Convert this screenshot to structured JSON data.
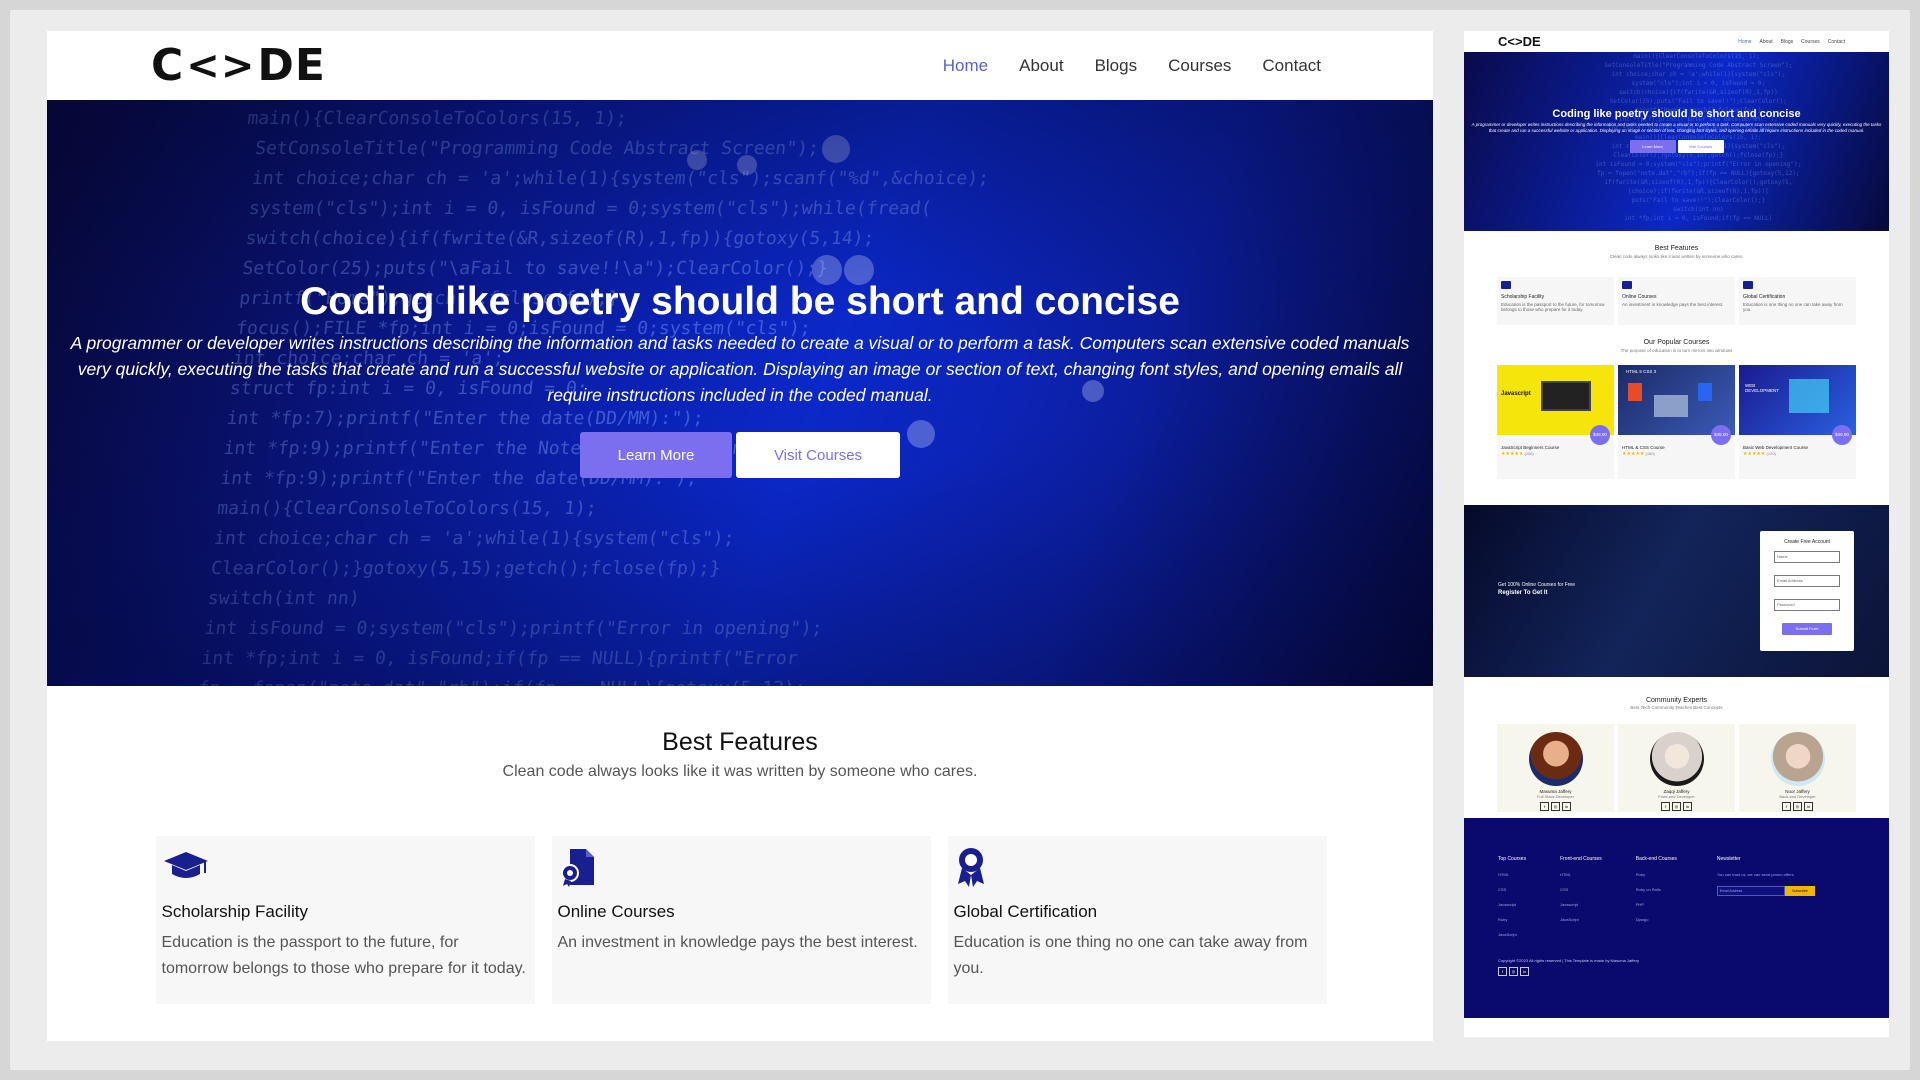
{
  "brand": {
    "logo_left": "C",
    "logo_symbol": "<>",
    "logo_right": "DE",
    "accent": "#7b6ff0",
    "navy": "#1a1f8f"
  },
  "nav": {
    "items": [
      {
        "label": "Home",
        "active": true
      },
      {
        "label": "About"
      },
      {
        "label": "Blogs"
      },
      {
        "label": "Courses"
      },
      {
        "label": "Contact"
      }
    ]
  },
  "hero": {
    "title": "Coding like poetry should be short and concise",
    "text": "A programmer or developer writes instructions describing the information and tasks needed to create a visual or to perform a task. Computers scan extensive coded manuals very quickly, executing the tasks that create and run a successful website or application. Displaying an image or section of text, changing font styles, and opening emails all require instructions included in the coded manual.",
    "primary_button": "Learn More",
    "secondary_button": "Visit Courses"
  },
  "features": {
    "title": "Best Features",
    "subtitle": "Clean code always looks like it was written by someone who cares.",
    "items": [
      {
        "icon": "graduation-cap-icon",
        "title": "Scholarship Facility",
        "text": "Education is the passport to the future, for tomorrow belongs to those who prepare for it today."
      },
      {
        "icon": "document-badge-icon",
        "title": "Online Courses",
        "text": "An investment in knowledge pays the best interest."
      },
      {
        "icon": "award-ribbon-icon",
        "title": "Global Certification",
        "text": "Education is one thing no one can take away from you."
      }
    ]
  },
  "preview": {
    "courses_title": "Our Popular Courses",
    "courses_subtitle": "The purpose of education is to turn mirrors into windows",
    "courses": [
      {
        "image_label": "Javascript",
        "price": "$49.00",
        "name": "JavaScript Beginners Course",
        "rating": "(256)"
      },
      {
        "image_label": "HTML 5 CSS 3",
        "price": "$49.00",
        "name": "HTML & CSS Course",
        "rating": "(160)"
      },
      {
        "image_label": "WEB DEVELOPMENT",
        "price": "$49.00",
        "name": "Basic Web Development Course",
        "rating": "(120)"
      }
    ],
    "register_line1": "Get 100% Online Courses for Free",
    "register_line2": "Register To Get It",
    "form_title": "Create Free Account",
    "form_fields": [
      "Name",
      "Email Address",
      "Password"
    ],
    "form_submit": "Submit Form",
    "experts_title": "Community Experts",
    "experts_subtitle": "Best Tech Community Teaches Best Concepts",
    "experts": [
      {
        "name": "Masuma Jaffery",
        "role": "Full Stack Developer"
      },
      {
        "name": "Zaqqi Jaffery",
        "role": "Front-end Developer"
      },
      {
        "name": "Noor Jaffery",
        "role": "Back-end Developer"
      }
    ],
    "footer_cols": [
      {
        "title": "Top Courses",
        "items": [
          "HTML",
          "CSS",
          "Javascript",
          "Ruby",
          "JavaScript"
        ]
      },
      {
        "title": "Front-end Courses",
        "items": [
          "HTML",
          "CSS",
          "Javascript",
          "JavaScript"
        ]
      },
      {
        "title": "Back-end Courses",
        "items": [
          "Ruby",
          "Ruby on Rails",
          "PHP",
          "Django"
        ]
      }
    ],
    "newsletter_title": "Newsletter",
    "newsletter_text": "You can trust us. we can send promo offers",
    "newsletter_placeholder": "Email Address",
    "newsletter_button": "Subscribe",
    "copyright": "Copyright ©2023 All rights reserved | This Template is made by Masuma Jaffery"
  }
}
